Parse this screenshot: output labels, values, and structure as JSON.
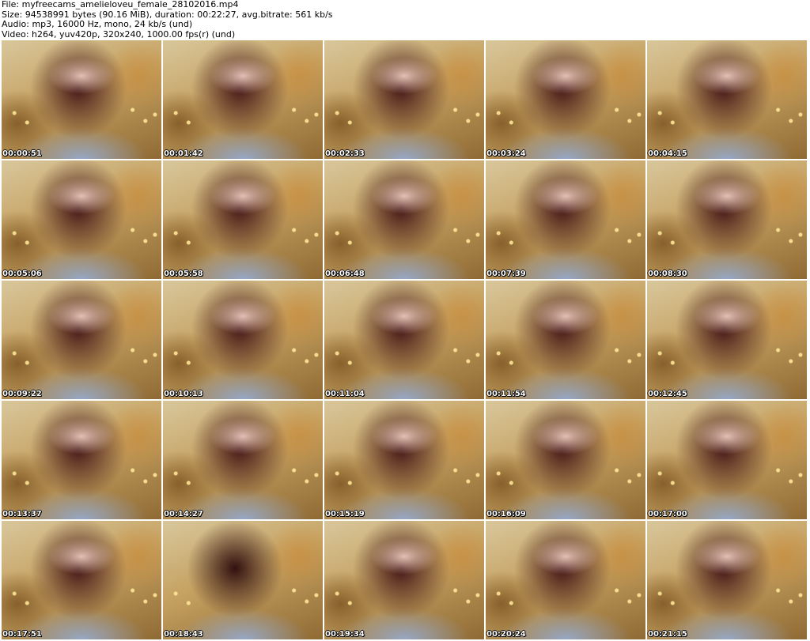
{
  "header": {
    "file": "File: myfreecams_amelieloveu_female_28102016.mp4",
    "size": "Size: 94538991 bytes (90.16 MiB), duration: 00:22:27, avg.bitrate: 561 kb/s",
    "audio": "Audio: mp3, 16000 Hz, mono, 24 kb/s (und)",
    "video": "Video: h264, yuv420p, 320x240, 1000.00 fps(r) (und)"
  },
  "thumbnails": [
    "00:00:51",
    "00:01:42",
    "00:02:33",
    "00:03:24",
    "00:04:15",
    "00:05:06",
    "00:05:58",
    "00:06:48",
    "00:07:39",
    "00:08:30",
    "00:09:22",
    "00:10:13",
    "00:11:04",
    "00:11:54",
    "00:12:45",
    "00:13:37",
    "00:14:27",
    "00:15:19",
    "00:16:09",
    "00:17:00",
    "00:17:51",
    "00:18:43",
    "00:19:34",
    "00:20:24",
    "00:21:15"
  ]
}
